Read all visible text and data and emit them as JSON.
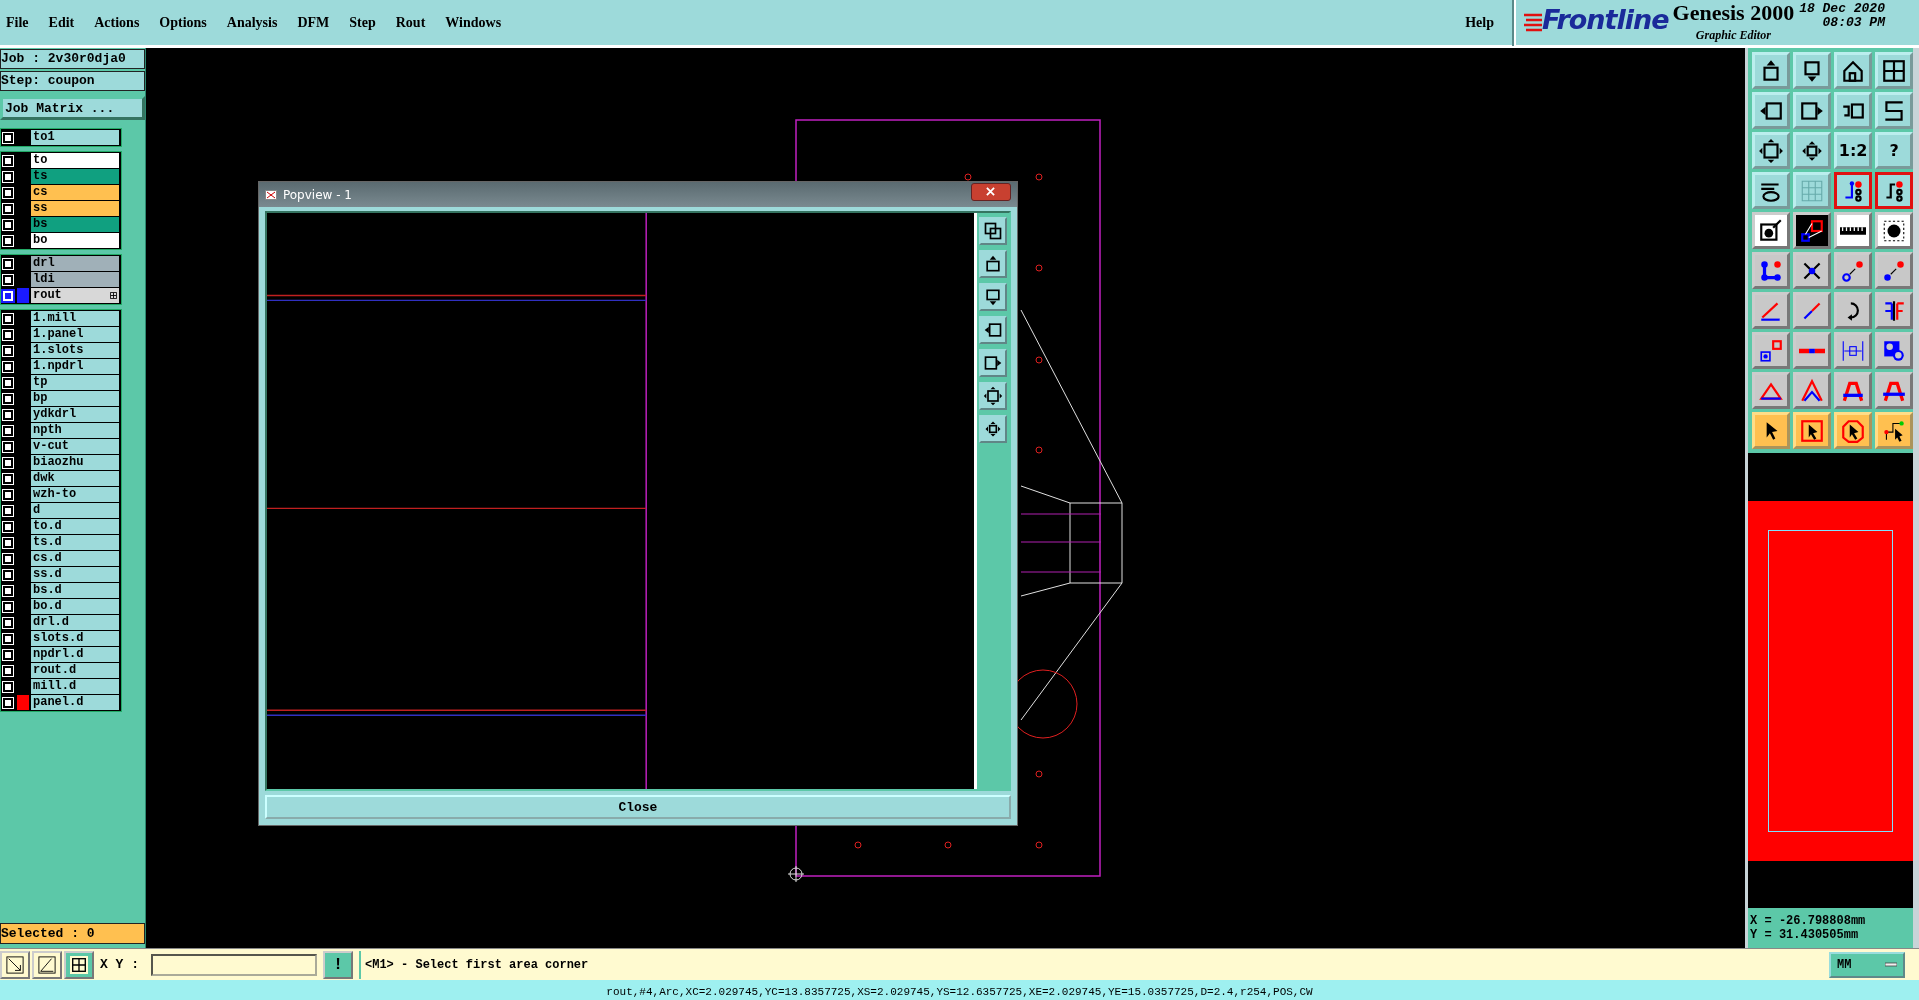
{
  "menu": [
    "File",
    "Edit",
    "Actions",
    "Options",
    "Analysis",
    "DFM",
    "Step",
    "Rout",
    "Windows"
  ],
  "help": "Help",
  "logo": {
    "brand": "Frontline",
    "product": "Genesis 2000",
    "subtitle": "Graphic Editor",
    "date": "18 Dec 2020",
    "time": "08:03 PM"
  },
  "job": "Job : 2v30r0dja0",
  "step": "Step: coupon",
  "job_matrix_button": "Job Matrix ...",
  "layer_groups": [
    {
      "layers": [
        {
          "name": "to1",
          "kind": "misc",
          "selected": false
        }
      ]
    },
    {
      "layers": [
        {
          "name": "to",
          "kind": "signal",
          "selected": false
        },
        {
          "name": "ts",
          "kind": "solder_mask",
          "selected": false
        },
        {
          "name": "cs",
          "kind": "silk_screen",
          "selected": false
        },
        {
          "name": "ss",
          "kind": "silk_screen",
          "selected": false
        },
        {
          "name": "bs",
          "kind": "solder_mask",
          "selected": false
        },
        {
          "name": "bo",
          "kind": "signal",
          "selected": false
        }
      ]
    },
    {
      "layers": [
        {
          "name": "drl",
          "kind": "drill",
          "selected": false
        },
        {
          "name": "ldi",
          "kind": "drill",
          "selected": false
        },
        {
          "name": "rout",
          "kind": "rout",
          "selected": true,
          "color": "#1a1aff"
        }
      ]
    },
    {
      "layers": [
        {
          "name": "1.mill",
          "kind": "misc",
          "selected": false
        },
        {
          "name": "1.panel",
          "kind": "misc",
          "selected": false
        },
        {
          "name": "1.slots",
          "kind": "misc",
          "selected": false
        },
        {
          "name": "1.npdrl",
          "kind": "misc",
          "selected": false
        },
        {
          "name": "tp",
          "kind": "misc",
          "selected": false
        },
        {
          "name": "bp",
          "kind": "misc",
          "selected": false
        },
        {
          "name": "ydkdrl",
          "kind": "misc",
          "selected": false
        },
        {
          "name": "npth",
          "kind": "misc",
          "selected": false
        },
        {
          "name": "v-cut",
          "kind": "misc",
          "selected": false
        },
        {
          "name": "biaozhu",
          "kind": "misc",
          "selected": false
        },
        {
          "name": "dwk",
          "kind": "misc",
          "selected": false
        },
        {
          "name": "wzh-to",
          "kind": "misc",
          "selected": false
        },
        {
          "name": "d",
          "kind": "misc",
          "selected": false
        },
        {
          "name": "to.d",
          "kind": "misc",
          "selected": false
        },
        {
          "name": "ts.d",
          "kind": "misc",
          "selected": false
        },
        {
          "name": "cs.d",
          "kind": "misc",
          "selected": false
        },
        {
          "name": "ss.d",
          "kind": "misc",
          "selected": false
        },
        {
          "name": "bs.d",
          "kind": "misc",
          "selected": false
        },
        {
          "name": "bo.d",
          "kind": "misc",
          "selected": false
        },
        {
          "name": "drl.d",
          "kind": "misc",
          "selected": false
        },
        {
          "name": "slots.d",
          "kind": "misc",
          "selected": false
        },
        {
          "name": "npdrl.d",
          "kind": "misc",
          "selected": false
        },
        {
          "name": "rout.d",
          "kind": "misc",
          "selected": false
        },
        {
          "name": "mill.d",
          "kind": "misc",
          "selected": false
        },
        {
          "name": "panel.d",
          "kind": "misc",
          "selected": false,
          "color": "#ff0000"
        }
      ]
    }
  ],
  "selected_count": "Selected : 0",
  "popview": {
    "title": "Popview - 1",
    "close_button": "Close"
  },
  "tool_labels": [
    "1:2",
    "?"
  ],
  "readout": {
    "x": "X = -26.798808mm",
    "y": "Y = 31.430505mm"
  },
  "bottom": {
    "xy_label": "X Y :",
    "alert_button": "!",
    "prompt": "<M1> - Select first area corner",
    "units": "MM"
  },
  "status": "rout,#4,Arc,XC=2.029745,YC=13.8357725,XS=2.029745,YS=12.6357725,XE=2.029745,YE=15.0357725,D=2.4,r254,POS,CW"
}
